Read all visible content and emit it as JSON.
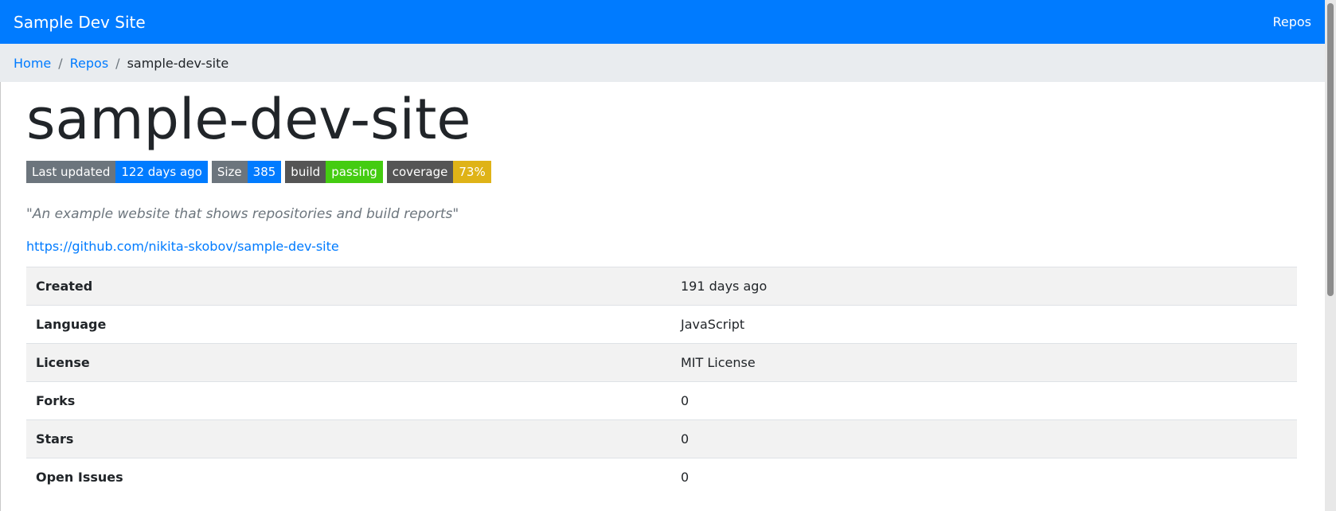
{
  "navbar": {
    "brand": "Sample Dev Site",
    "link": "Repos",
    "color": "#007bff"
  },
  "breadcrumb": {
    "items": [
      "Home",
      "Repos"
    ],
    "separator": "/",
    "active": "sample-dev-site"
  },
  "repo": {
    "title": "sample-dev-site",
    "description": "\"An example website that shows repositories and build reports\"",
    "url": "https://github.com/nikita-skobov/sample-dev-site"
  },
  "badges": [
    {
      "label": "Last updated",
      "value": "122 days ago",
      "value_color": "#007bff"
    },
    {
      "label": "Size",
      "value": "385",
      "value_color": "#007bff"
    },
    {
      "label": "build",
      "value": "passing",
      "value_color": "#44cc11"
    },
    {
      "label": "coverage",
      "value": "73%",
      "value_color": "#dfb317"
    }
  ],
  "details": [
    {
      "key": "Created",
      "value": "191 days ago"
    },
    {
      "key": "Language",
      "value": "JavaScript"
    },
    {
      "key": "License",
      "value": "MIT License"
    },
    {
      "key": "Forks",
      "value": "0"
    },
    {
      "key": "Stars",
      "value": "0"
    },
    {
      "key": "Open Issues",
      "value": "0"
    }
  ]
}
